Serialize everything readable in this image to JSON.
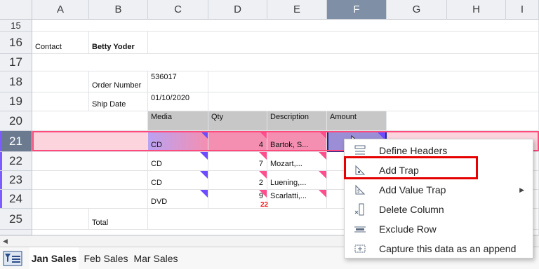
{
  "columns": [
    "A",
    "B",
    "C",
    "D",
    "E",
    "F",
    "G",
    "H",
    "I"
  ],
  "rows": [
    "15",
    "16",
    "17",
    "18",
    "19",
    "20",
    "21",
    "22",
    "23",
    "24",
    "25"
  ],
  "cells": {
    "a16": "Contact",
    "b16": "Betty Yoder",
    "b18": "Order Number",
    "c18": "536017",
    "b19": "Ship Date",
    "c19": "01/10/2020",
    "c20": "Media",
    "d20": "Qty",
    "e20": "Description",
    "f20": "Amount",
    "c21": "CD",
    "d21": "4",
    "e21": "Bartok, S...",
    "c22": "CD",
    "d22": "7",
    "e22": "Mozart,...",
    "c23": "CD",
    "d23": "2",
    "e23": "Luening,...",
    "c24": "DVD",
    "d24": "9",
    "e24": "Scarlatti,...",
    "total_red": "22",
    "b25": "Total"
  },
  "context_menu": {
    "items": [
      {
        "label": "Define Headers",
        "icon": "define-headers-icon"
      },
      {
        "label": "Add Trap",
        "icon": "add-trap-icon"
      },
      {
        "label": "Add Value Trap",
        "icon": "add-value-trap-icon",
        "submenu": true
      },
      {
        "label": "Delete Column",
        "icon": "delete-column-icon"
      },
      {
        "label": "Exclude Row",
        "icon": "exclude-row-icon"
      },
      {
        "label": "Capture this data as an append",
        "icon": "capture-append-icon"
      }
    ],
    "highlighted": "Add Trap",
    "highlight_color": "#e60000"
  },
  "sheet_tabs": [
    "Jan Sales",
    "Feb Sales",
    "Mar Sales"
  ],
  "active_tab": "Jan Sales",
  "colors": {
    "selected_row": "#ff4a7d",
    "header_fill": "#c7c7c7",
    "trap_marker": "#6d4bff"
  }
}
